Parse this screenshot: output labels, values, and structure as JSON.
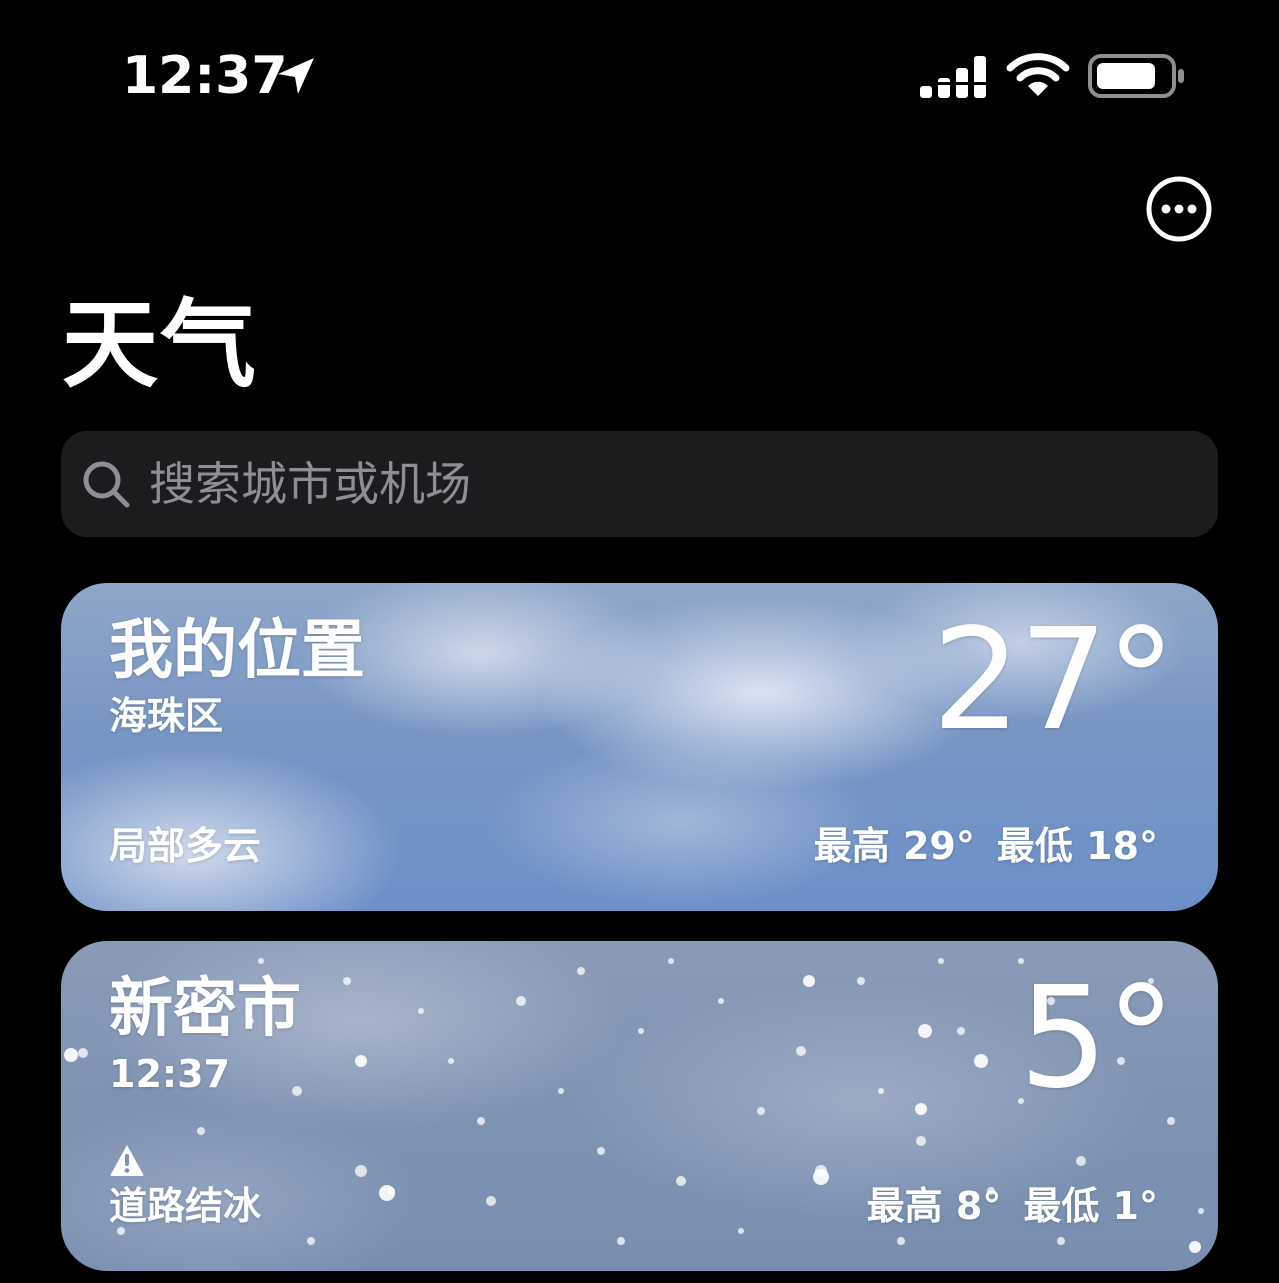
{
  "status_bar": {
    "time": "12:37",
    "icons": [
      "location-arrow-icon",
      "signal-icon",
      "wifi-icon",
      "battery-icon"
    ]
  },
  "header": {
    "title": "天气",
    "more_icon": "ellipsis-circle-icon"
  },
  "search": {
    "placeholder": "搜索城市或机场",
    "icon": "search-icon"
  },
  "cards": [
    {
      "city": "我的位置",
      "subtitle": "海珠区",
      "temperature": "27°",
      "condition": "局部多云",
      "high": "最高 29°",
      "low": "最低 18°"
    },
    {
      "city": "新密市",
      "subtitle": "12:37",
      "temperature": "5°",
      "alert_icon": "warning-icon",
      "condition": "道路结冰",
      "high": "最高 8°",
      "low": "最低 1°"
    }
  ],
  "colors": {
    "background": "#000000",
    "search_background": "#1c1c1e",
    "placeholder": "#8e8e93",
    "text": "#ffffff"
  }
}
